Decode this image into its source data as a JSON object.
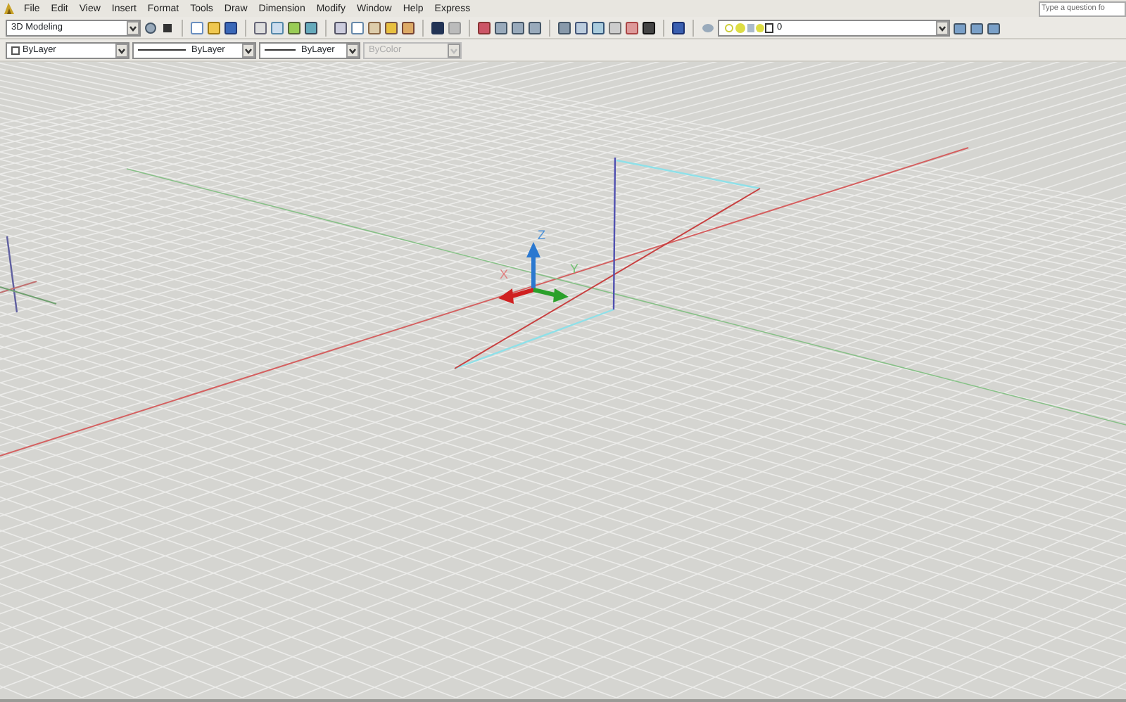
{
  "menu_bar": {
    "items": [
      "File",
      "Edit",
      "View",
      "Insert",
      "Format",
      "Tools",
      "Draw",
      "Dimension",
      "Modify",
      "Window",
      "Help",
      "Express"
    ]
  },
  "help_search": {
    "value": "Type a question fo"
  },
  "workspace_dropdown": {
    "value": "3D Modeling"
  },
  "layer_dropdown": {
    "value": "0"
  },
  "properties": [
    {
      "kind": "color",
      "value": "ByLayer",
      "disabled": false
    },
    {
      "kind": "linetype",
      "value": "ByLayer",
      "disabled": false
    },
    {
      "kind": "lineweight",
      "value": "ByLayer",
      "disabled": false
    },
    {
      "kind": "plotstyle",
      "value": "ByColor",
      "disabled": true
    }
  ],
  "viewport": {
    "ucs_labels": [
      "Z",
      "X",
      "Y"
    ]
  }
}
